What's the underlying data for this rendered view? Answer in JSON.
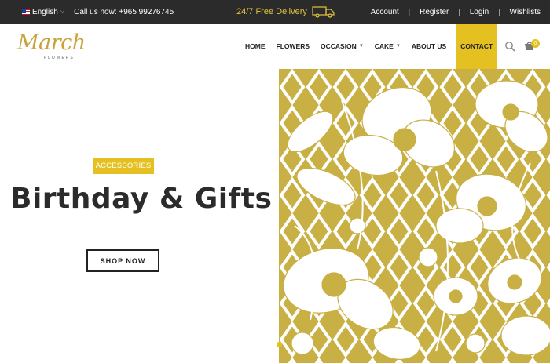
{
  "topbar": {
    "language": "English",
    "call": "Call us now: +965 99276745",
    "delivery": "24/7 Free Delivery",
    "links": [
      "Account",
      "Register",
      "Login",
      "Wishlists"
    ]
  },
  "header": {
    "logo_script": "March",
    "logo_sub": "FLOWERS",
    "nav": [
      {
        "label": "HOME"
      },
      {
        "label": "FLOWERS"
      },
      {
        "label": "OCCASION"
      },
      {
        "label": "CAKE"
      },
      {
        "label": "ABOUT US"
      },
      {
        "label": "CONTACT"
      }
    ],
    "cart_count": "0"
  },
  "hero": {
    "badge": "ACCESSORIES",
    "title": "Birthday & Gifts",
    "button": "SHOP NOW"
  },
  "colors": {
    "accent": "#e4c020",
    "topbar": "#2b2b2b",
    "delivery_text": "#e3c43c",
    "pattern_gold": "#c9b045"
  },
  "icons": [
    "flag-us-icon",
    "chevron-down-icon",
    "delivery-truck-icon",
    "search-icon",
    "cart-icon",
    "caret-down-icon"
  ]
}
